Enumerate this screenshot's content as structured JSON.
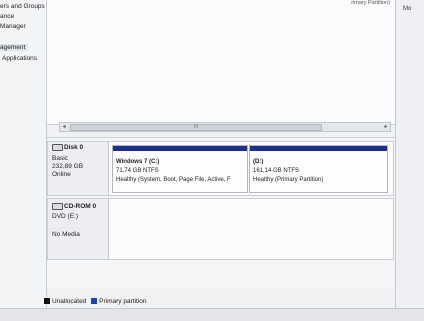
{
  "nav": {
    "items": [
      {
        "label": "ers and Groups"
      },
      {
        "label": "ance"
      },
      {
        "label": "Manager"
      },
      {
        "label": "agement"
      },
      {
        "label": "Applications"
      }
    ]
  },
  "top_list": {
    "partial_text": "rimary Partition)"
  },
  "right_pane": {
    "header": "Mo"
  },
  "scrollbar": {
    "thumb_grip": "III"
  },
  "disks": [
    {
      "name": "Disk 0",
      "type": "Basic",
      "size": "232,89 GB",
      "status": "Online",
      "partitions": [
        {
          "name": "Windows 7  (C:)",
          "size": "71,74 GB NTFS",
          "status": "Healthy (System, Boot, Page File, Active, F"
        },
        {
          "name": "(D:)",
          "size": "161,14 GB NTFS",
          "status": "Healthy (Primary Partition)"
        }
      ]
    },
    {
      "name": "CD-ROM 0",
      "type": "DVD (E:)",
      "status": "No Media"
    }
  ],
  "legend": [
    {
      "label": "Unallocated",
      "color": "#111111"
    },
    {
      "label": "Primary partition",
      "color": "#1f3fb5"
    }
  ],
  "colors": {
    "partition_bar": "#1e2e8c"
  }
}
